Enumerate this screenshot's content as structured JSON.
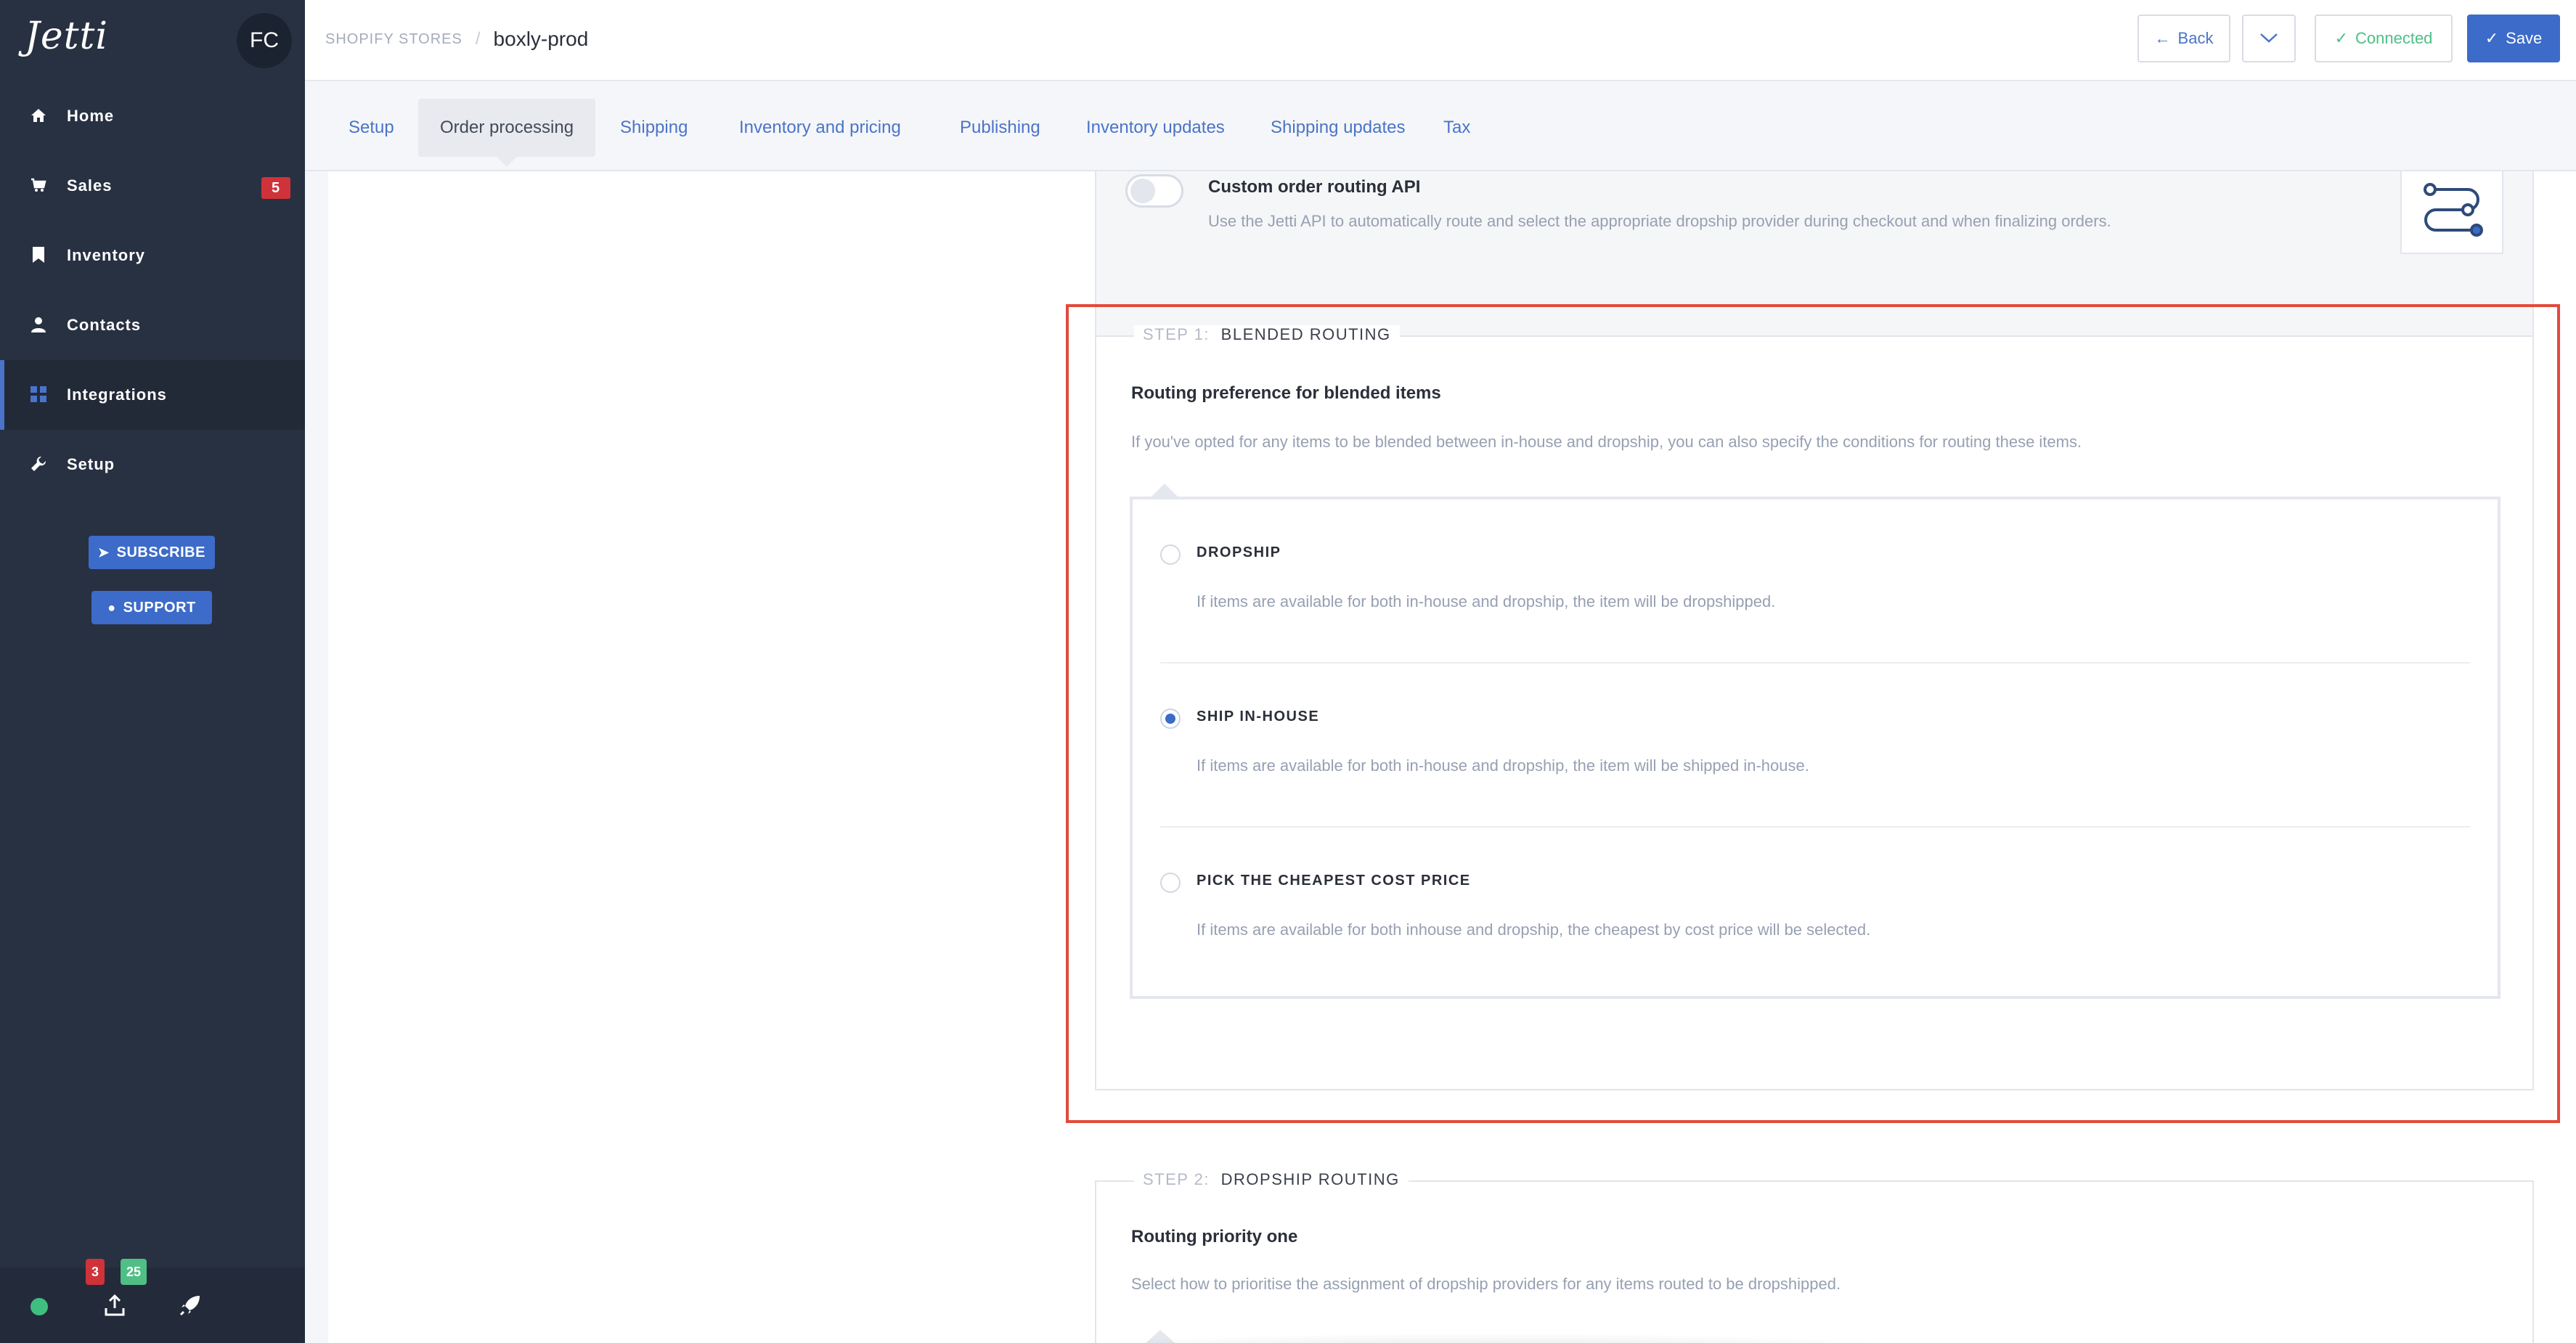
{
  "brand": {
    "logo": "Jetti",
    "avatar_initials": "FC"
  },
  "sidebar": {
    "items": [
      {
        "label": "Home",
        "icon": "home-icon"
      },
      {
        "label": "Sales",
        "icon": "cart-icon",
        "badge": "5"
      },
      {
        "label": "Inventory",
        "icon": "bookmark-icon"
      },
      {
        "label": "Contacts",
        "icon": "person-icon"
      },
      {
        "label": "Integrations",
        "icon": "grid-icon",
        "active": true
      },
      {
        "label": "Setup",
        "icon": "wrench-icon"
      }
    ],
    "subscribe_label": "SUBSCRIBE",
    "support_label": "SUPPORT",
    "footer": {
      "upload_badge_red": "3",
      "upload_badge_green": "25",
      "status_color": "#3fbf7f"
    }
  },
  "header": {
    "breadcrumb_parent": "SHOPIFY STORES",
    "breadcrumb_sep": "/",
    "title": "boxly-prod",
    "back_label": "Back",
    "connected_label": "Connected",
    "save_label": "Save"
  },
  "tabs": [
    {
      "label": "Setup"
    },
    {
      "label": "Order processing",
      "active": true
    },
    {
      "label": "Shipping"
    },
    {
      "label": "Inventory and pricing"
    },
    {
      "label": "Publishing"
    },
    {
      "label": "Inventory updates"
    },
    {
      "label": "Shipping updates"
    },
    {
      "label": "Tax"
    }
  ],
  "custom_api": {
    "title": "Custom order routing API",
    "description": "Use the Jetti API to automatically route and select the appropriate dropship provider during checkout and when finalizing orders.",
    "enabled": false
  },
  "step1": {
    "step": "STEP 1:",
    "name": "BLENDED ROUTING",
    "title": "Routing preference for blended items",
    "description": "If you've opted for any items to be blended between in-house and dropship, you can also specify the conditions for routing these items.",
    "options": [
      {
        "label": "DROPSHIP",
        "description": "If items are available for both in-house and dropship, the item will be dropshipped.",
        "checked": false
      },
      {
        "label": "SHIP IN-HOUSE",
        "description": "If items are available for both in-house and dropship, the item will be shipped in-house.",
        "checked": true
      },
      {
        "label": "PICK THE CHEAPEST COST PRICE",
        "description": "If items are available for both inhouse and dropship, the cheapest by cost price will be selected.",
        "checked": false
      }
    ]
  },
  "step2": {
    "step": "STEP 2:",
    "name": "DROPSHIP ROUTING",
    "title": "Routing priority one",
    "description": "Select how to prioritise the assignment of dropship providers for any items routed to be dropshipped."
  },
  "colors": {
    "accent": "#3c6bc9",
    "sidebar": "#283142",
    "highlight": "#e24a3b",
    "connected": "#4fbf86",
    "badge": "#d0323a"
  }
}
